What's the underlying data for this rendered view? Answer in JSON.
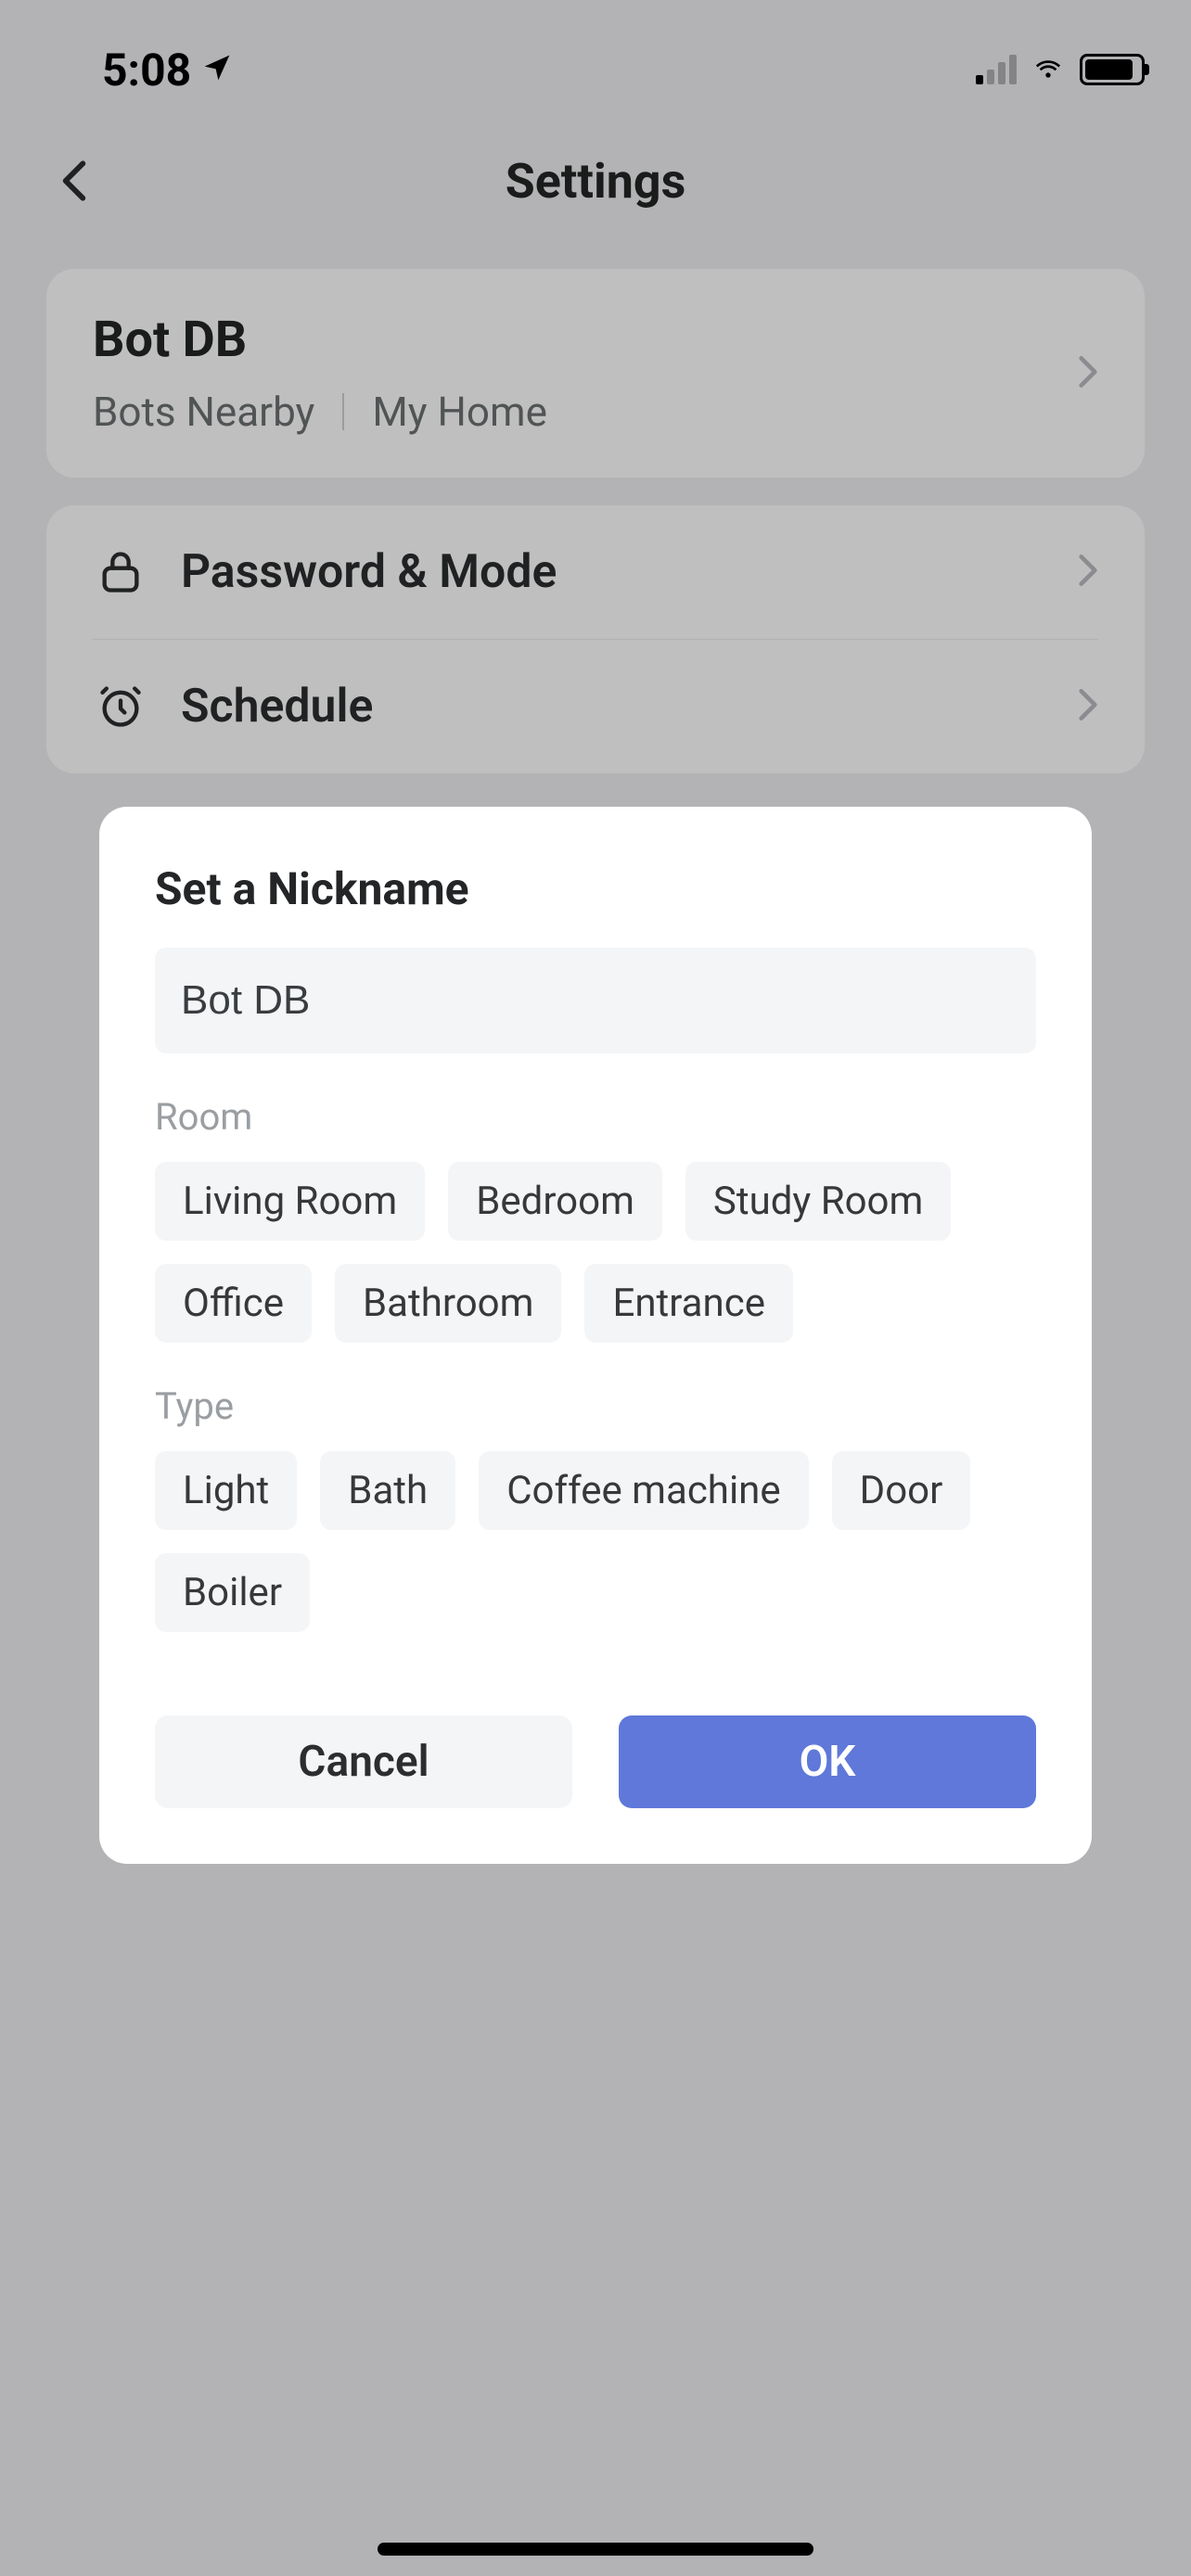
{
  "status": {
    "time": "5:08",
    "signal_strength": 1
  },
  "nav": {
    "title": "Settings"
  },
  "device": {
    "name": "Bot DB",
    "sub1": "Bots Nearby",
    "sub2": "My Home"
  },
  "rows": {
    "password": "Password & Mode",
    "schedule": "Schedule"
  },
  "dialog": {
    "title": "Set a Nickname",
    "input_value": "Bot DB",
    "room_label": "Room",
    "rooms": [
      "Living Room",
      "Bedroom",
      "Study Room",
      "Office",
      "Bathroom",
      "Entrance"
    ],
    "type_label": "Type",
    "types": [
      "Light",
      "Bath",
      "Coffee machine",
      "Door",
      "Boiler"
    ],
    "cancel": "Cancel",
    "ok": "OK"
  }
}
